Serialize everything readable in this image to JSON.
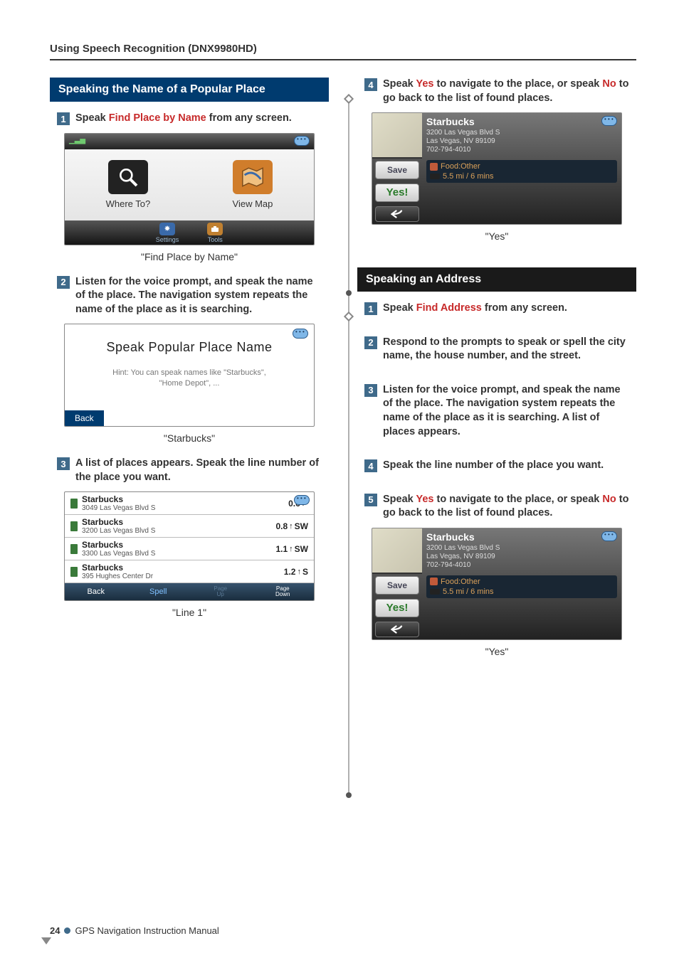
{
  "header": "Using Speech Recognition (DNX9980HD)",
  "left": {
    "section_title": "Speaking the Name of a Popular Place",
    "step1": {
      "num": "1",
      "pre": "Speak ",
      "cmd": "Find Place by Name",
      "post": " from any screen."
    },
    "main_menu": {
      "where_to": "Where To?",
      "view_map": "View Map",
      "settings": "Settings",
      "tools": "Tools"
    },
    "caption1": "\"Find Place by Name\"",
    "step2": {
      "num": "2",
      "text": "Listen for the voice prompt, and speak the name of the place. The navigation system repeats the name of the place as it is searching."
    },
    "speak_screen": {
      "title": "Speak Popular Place Name",
      "hint1": "Hint: You can speak names like \"Starbucks\",",
      "hint2": "\"Home Depot\", ...",
      "back": "Back"
    },
    "caption2": "\"Starbucks\"",
    "step3": {
      "num": "3",
      "text": "A list of places appears. Speak the line number of the place you want."
    },
    "results": [
      {
        "name": "Starbucks",
        "addr": "3049 Las Vegas Blvd S",
        "dist": "0.6",
        "dir": ""
      },
      {
        "name": "Starbucks",
        "addr": "3200 Las Vegas Blvd S",
        "dist": "0.8",
        "dir": "SW"
      },
      {
        "name": "Starbucks",
        "addr": "3300 Las Vegas Blvd S",
        "dist": "1.1",
        "dir": "SW"
      },
      {
        "name": "Starbucks",
        "addr": "395 Hughes Center Dr",
        "dist": "1.2",
        "dir": "S"
      }
    ],
    "results_footer": {
      "back": "Back",
      "spell": "Spell",
      "page_up": "Page\nUp",
      "page_down": "Page\nDown"
    },
    "caption3": "\"Line 1\""
  },
  "right": {
    "step4": {
      "num": "4",
      "pre": "Speak ",
      "yes": "Yes",
      "mid": " to navigate to the place, or speak ",
      "no": "No",
      "post": " to go back to the list of found places."
    },
    "go_screen": {
      "name": "Starbucks",
      "addr1": "3200 Las Vegas Blvd S",
      "addr2": "Las Vegas, NV 89109",
      "phone": "702-794-4010",
      "food": "Food:Other",
      "dist": "5.5 mi /  6 mins",
      "save": "Save",
      "yes": "Yes!"
    },
    "caption_yes": "\"Yes\"",
    "section2_title": "Speaking an Address",
    "s2_step1": {
      "num": "1",
      "pre": "Speak ",
      "cmd": "Find Address",
      "post": " from any screen."
    },
    "s2_step2": {
      "num": "2",
      "text": "Respond to the prompts to speak or spell the city name, the house number, and the street."
    },
    "s2_step3": {
      "num": "3",
      "text": "Listen for the voice prompt, and speak the name of the place. The navigation system repeats the name of the place as it is searching. A list of places appears."
    },
    "s2_step4": {
      "num": "4",
      "text": "Speak the line number of the place you want."
    },
    "s2_step5": {
      "num": "5",
      "pre": "Speak ",
      "yes": "Yes",
      "mid": " to navigate to the place, or speak ",
      "no": "No",
      "post": " to go back to the list of found places."
    }
  },
  "footer": {
    "page": "24",
    "title": "GPS Navigation Instruction Manual"
  }
}
